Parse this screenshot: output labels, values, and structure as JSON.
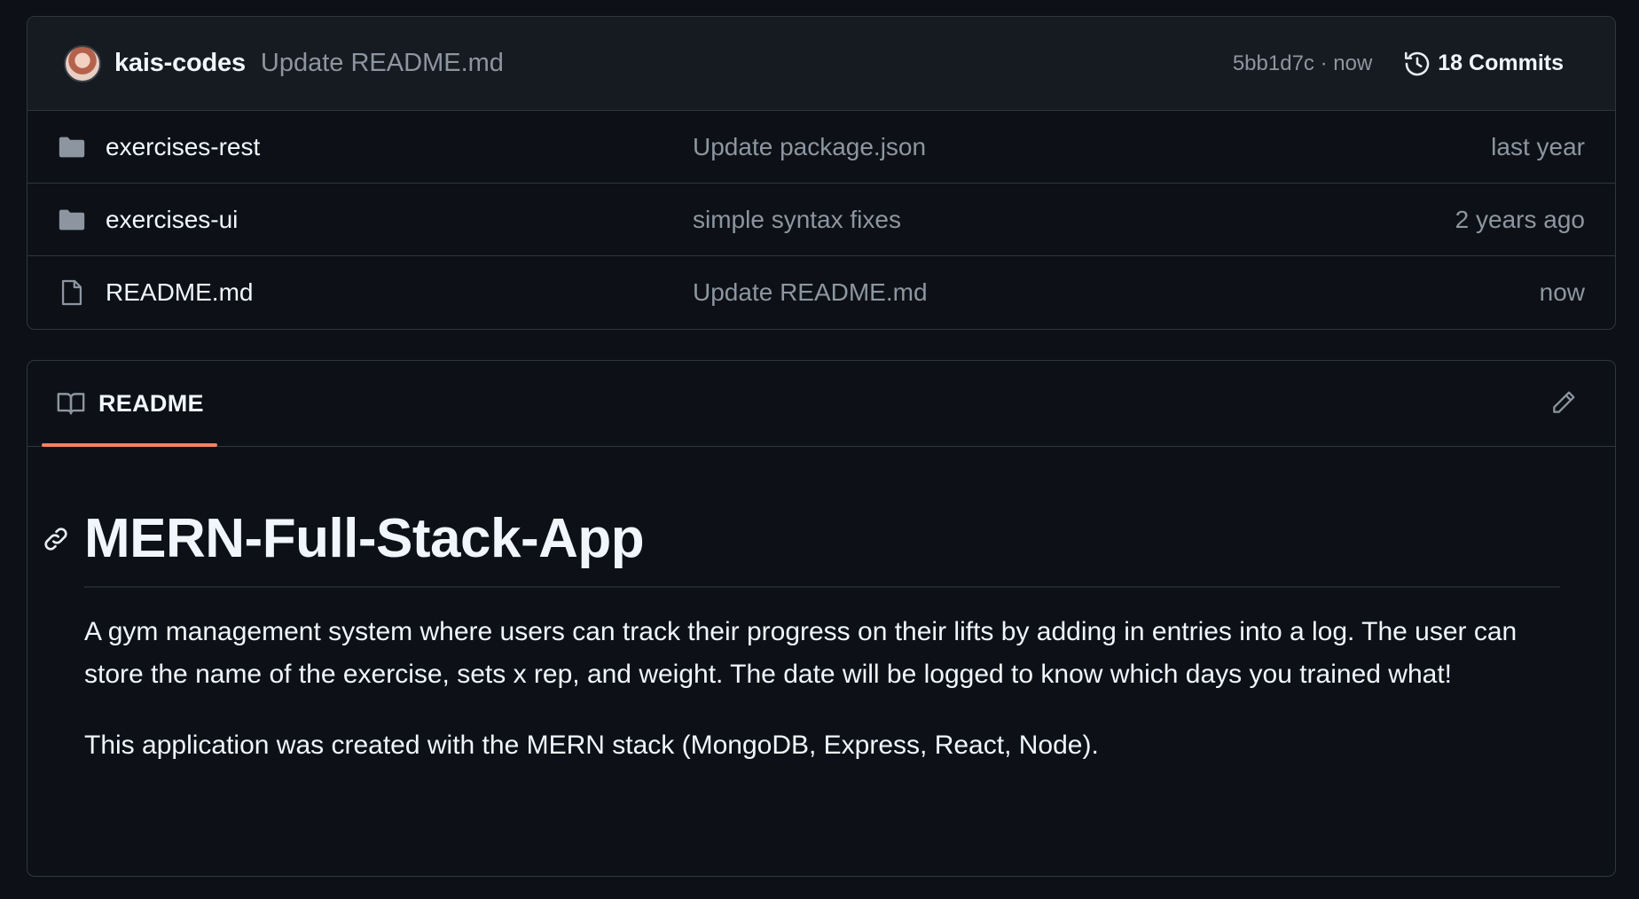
{
  "commit_bar": {
    "author": "kais-codes",
    "message": "Update README.md",
    "sha_time": "5bb1d7c · now",
    "commits_label": "18 Commits"
  },
  "files": [
    {
      "name": "exercises-rest",
      "type": "folder",
      "commit": "Update package.json",
      "time": "last year"
    },
    {
      "name": "exercises-ui",
      "type": "folder",
      "commit": "simple syntax fixes",
      "time": "2 years ago"
    },
    {
      "name": "README.md",
      "type": "file",
      "commit": "Update README.md",
      "time": "now"
    }
  ],
  "readme": {
    "tab_label": "README",
    "title": "MERN-Full-Stack-App",
    "paragraphs": [
      "A gym management system where users can track their progress on their lifts by adding in entries into a log. The user can store the name of the exercise, sets x rep, and weight. The date will be logged to know which days you trained what!",
      "This application was created with the MERN stack (MongoDB, Express, React, Node)."
    ]
  },
  "icons": {
    "folder": "folder-icon",
    "file": "file-icon",
    "history": "history-icon",
    "book": "book-icon",
    "edit": "pencil-icon",
    "anchor": "link-icon"
  },
  "colors": {
    "background": "#0d1117",
    "header_bg": "#161b22",
    "border": "#30363d",
    "muted_text": "#8d96a0",
    "tab_accent": "#f78166"
  }
}
